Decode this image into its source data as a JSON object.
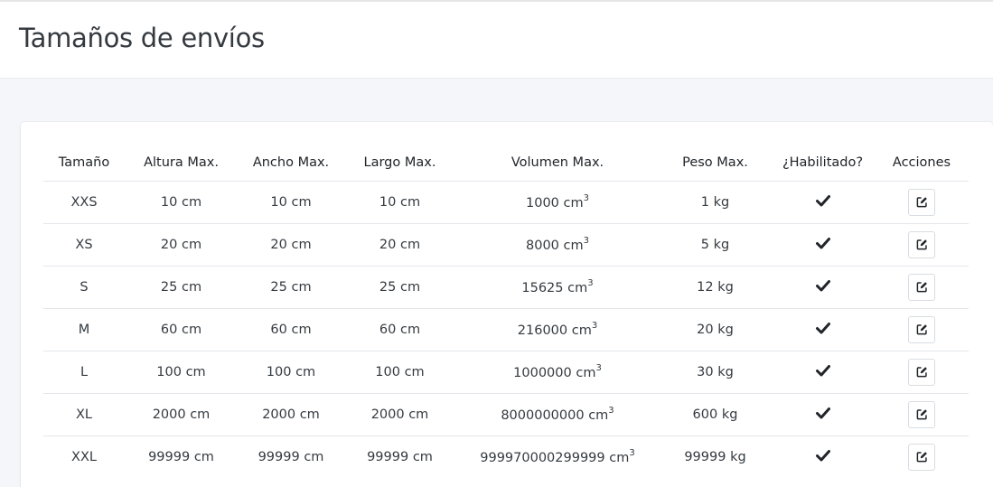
{
  "page": {
    "title": "Tamaños de envíos"
  },
  "table": {
    "headers": {
      "size": "Tamaño",
      "height": "Altura Max.",
      "width": "Ancho Max.",
      "length": "Largo Max.",
      "volume": "Volumen Max.",
      "weight": "Peso Max.",
      "enabled": "¿Habilitado?",
      "actions": "Acciones"
    },
    "volume_unit": "cm",
    "volume_exponent": "3",
    "rows": [
      {
        "size": "XXS",
        "height": "10 cm",
        "width": "10 cm",
        "length": "10 cm",
        "volume": "1000",
        "weight": "1 kg",
        "enabled": true
      },
      {
        "size": "XS",
        "height": "20 cm",
        "width": "20 cm",
        "length": "20 cm",
        "volume": "8000",
        "weight": "5 kg",
        "enabled": true
      },
      {
        "size": "S",
        "height": "25 cm",
        "width": "25 cm",
        "length": "25 cm",
        "volume": "15625",
        "weight": "12 kg",
        "enabled": true
      },
      {
        "size": "M",
        "height": "60 cm",
        "width": "60 cm",
        "length": "60 cm",
        "volume": "216000",
        "weight": "20 kg",
        "enabled": true
      },
      {
        "size": "L",
        "height": "100 cm",
        "width": "100 cm",
        "length": "100 cm",
        "volume": "1000000",
        "weight": "30 kg",
        "enabled": true
      },
      {
        "size": "XL",
        "height": "2000 cm",
        "width": "2000 cm",
        "length": "2000 cm",
        "volume": "8000000000",
        "weight": "600 kg",
        "enabled": true
      },
      {
        "size": "XXL",
        "height": "99999 cm",
        "width": "99999 cm",
        "length": "99999 cm",
        "volume": "999970000299999",
        "weight": "99999 kg",
        "enabled": true
      }
    ]
  },
  "icons": {
    "enabled": "check-icon",
    "edit": "edit-icon"
  }
}
